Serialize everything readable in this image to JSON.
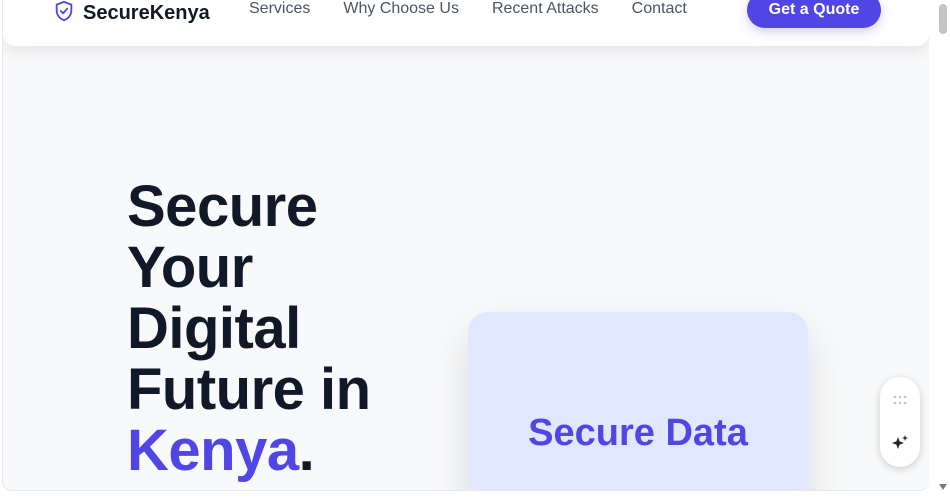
{
  "nav": {
    "brand": "SecureKenya",
    "brand_icon": "shield-check-icon",
    "links": [
      "Services",
      "Why Choose Us",
      "Recent Attacks",
      "Contact"
    ],
    "cta_label": "Get a Quote"
  },
  "hero": {
    "title_lines": [
      "Secure",
      "Your",
      "Digital",
      "Future in"
    ],
    "title_accent": "Kenya",
    "title_end": "."
  },
  "card": {
    "title": "Secure Data"
  },
  "widget": {
    "top_icon": "drag-handle-icon",
    "bottom_icon": "sparkle-icon"
  },
  "colors": {
    "accent": "#5046e5",
    "heading": "#111827",
    "card_bg": "#e0e7ff",
    "page_bg": "#f8f9fa"
  }
}
